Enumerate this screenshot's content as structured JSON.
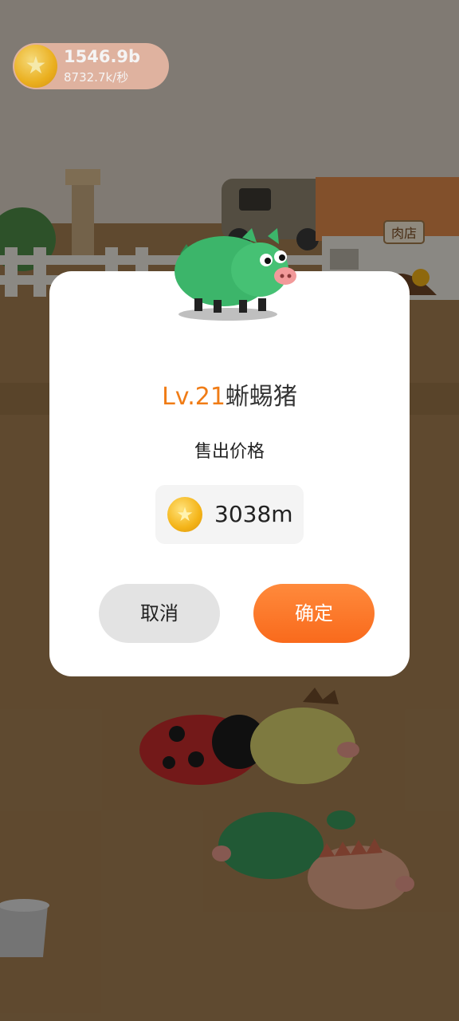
{
  "hud": {
    "coin_total": "1546.9b",
    "coin_rate": "8732.7k/秒",
    "coin_icon": "gold-star-coin-icon"
  },
  "scene": {
    "shop_sign": "肉店",
    "objects": [
      "delivery-van",
      "butcher-shop",
      "stone-pillar",
      "wooden-fence",
      "trash-can",
      "pigs"
    ]
  },
  "dialog": {
    "pig_level": "Lv.21",
    "pig_name": "蜥蜴猪",
    "price_label": "售出价格",
    "price_value": "3038m",
    "cancel_label": "取消",
    "confirm_label": "确定"
  },
  "colors": {
    "level_text": "#f07c16",
    "confirm_button": "#f96a1c",
    "cancel_button": "#e3e3e3",
    "coin": "#f4b418",
    "ground": "#9c7a4e"
  }
}
